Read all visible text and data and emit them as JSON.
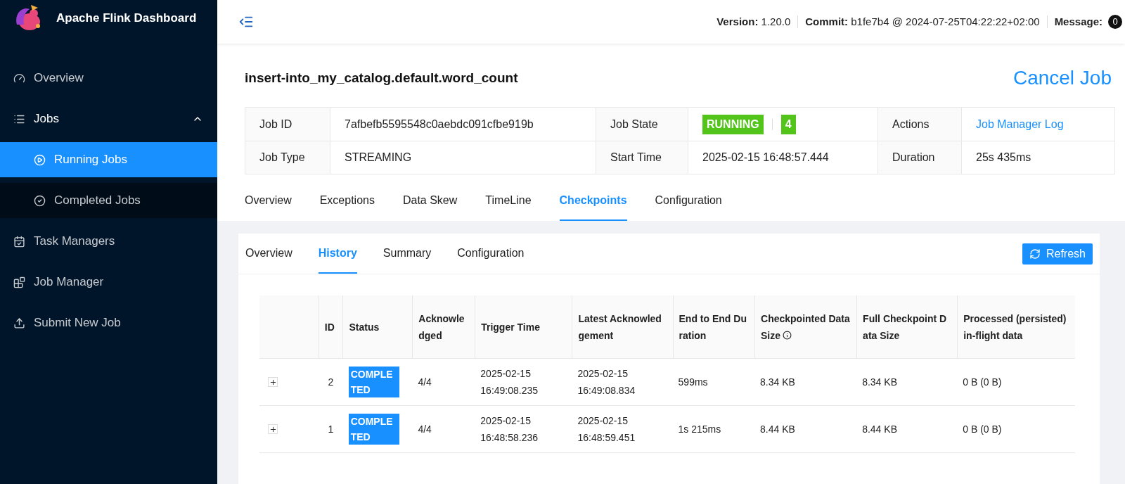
{
  "brand": {
    "title": "Apache Flink Dashboard"
  },
  "sidebar": {
    "items": [
      {
        "label": "Overview",
        "selected": false
      },
      {
        "label": "Jobs",
        "selected": false,
        "expanded": true,
        "children": [
          {
            "label": "Running Jobs",
            "selected": true
          },
          {
            "label": "Completed Jobs",
            "selected": false
          }
        ]
      },
      {
        "label": "Task Managers",
        "selected": false
      },
      {
        "label": "Job Manager",
        "selected": false
      },
      {
        "label": "Submit New Job",
        "selected": false
      }
    ]
  },
  "header": {
    "items": [
      {
        "label": "Version:",
        "value": "1.20.0"
      },
      {
        "label": "Commit:",
        "value": "b1fe7b4 @ 2024-07-25T04:22:22+02:00"
      }
    ],
    "message_label": "Message:",
    "message_count": "0"
  },
  "job": {
    "name": "insert-into_my_catalog.default.word_count",
    "cancel": "Cancel Job"
  },
  "info": {
    "rows": [
      [
        {
          "kind": "label",
          "text": "Job ID"
        },
        {
          "kind": "text",
          "text": "7afbefb5595548c0aebdc091cfbe919b"
        },
        {
          "kind": "label",
          "text": "Job State"
        },
        {
          "kind": "badges",
          "texts": [
            "RUNNING",
            "4"
          ]
        },
        {
          "kind": "label",
          "text": "Actions"
        },
        {
          "kind": "link",
          "text": "Job Manager Log"
        }
      ],
      [
        {
          "kind": "label",
          "text": "Job Type"
        },
        {
          "kind": "text",
          "text": "STREAMING"
        },
        {
          "kind": "label",
          "text": "Start Time"
        },
        {
          "kind": "text",
          "text": "2025-02-15 16:48:57.444"
        },
        {
          "kind": "label",
          "text": "Duration"
        },
        {
          "kind": "text",
          "text": "25s 435ms"
        }
      ]
    ]
  },
  "tabs": [
    {
      "label": "Overview",
      "selected": false
    },
    {
      "label": "Exceptions",
      "selected": false
    },
    {
      "label": "Data Skew",
      "selected": false
    },
    {
      "label": "TimeLine",
      "selected": false
    },
    {
      "label": "Checkpoints",
      "selected": true
    },
    {
      "label": "Configuration",
      "selected": false
    }
  ],
  "subtabs": [
    {
      "label": "Overview",
      "selected": false
    },
    {
      "label": "History",
      "selected": true
    },
    {
      "label": "Summary",
      "selected": false
    },
    {
      "label": "Configuration",
      "selected": false
    }
  ],
  "refresh": "Refresh",
  "table": {
    "columns": [
      {
        "label": "ID"
      },
      {
        "label": "Status"
      },
      {
        "label": "Acknowledged"
      },
      {
        "label": "Trigger Time"
      },
      {
        "label": "Latest Acknowledgement"
      },
      {
        "label": "End to End Duration"
      },
      {
        "label": "Checkpointed Data Size",
        "info": true
      },
      {
        "label": "Full Checkpoint Data Size"
      },
      {
        "label": "Processed (persisted) in-flight data"
      }
    ],
    "rows": [
      {
        "expanded": false,
        "cells": [
          "2",
          "COMPLETED",
          "4/4",
          "2025-02-15 16:49:08.235",
          "2025-02-15 16:49:08.834",
          "599ms",
          "8.34 KB",
          "8.34 KB",
          "0 B (0 B)"
        ]
      },
      {
        "expanded": false,
        "cells": [
          "1",
          "COMPLETED",
          "4/4",
          "2025-02-15 16:48:58.236",
          "2025-02-15 16:48:59.451",
          "1s 215ms",
          "8.44 KB",
          "8.44 KB",
          "0 B (0 B)"
        ]
      }
    ]
  }
}
